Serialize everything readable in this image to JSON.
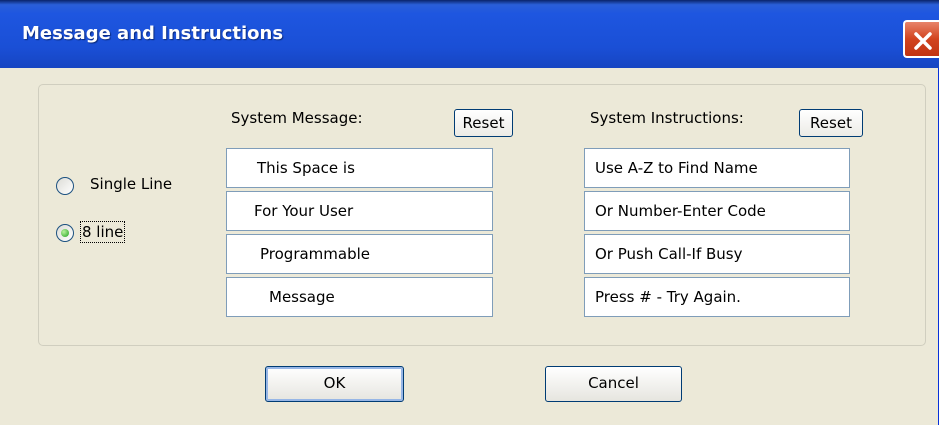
{
  "window": {
    "title": "Message and Instructions"
  },
  "mode": {
    "options": [
      {
        "label": "Single Line",
        "selected": false
      },
      {
        "label": "8 line",
        "selected": true
      }
    ]
  },
  "system_message": {
    "label": "System Message:",
    "reset_label": "Reset",
    "lines": [
      "This Space is",
      "For Your User",
      "Programmable",
      "Message"
    ]
  },
  "system_instructions": {
    "label": "System Instructions:",
    "reset_label": "Reset",
    "lines": [
      "Use A-Z to Find Name",
      "Or Number-Enter Code",
      "Or Push Call-If Busy",
      "Press # - Try Again."
    ]
  },
  "buttons": {
    "ok_label": "OK",
    "cancel_label": "Cancel"
  },
  "colors": {
    "title_bar": "#1A4FD6",
    "dialog_bg": "#ECE9D8",
    "close_button": "#D2431E"
  }
}
